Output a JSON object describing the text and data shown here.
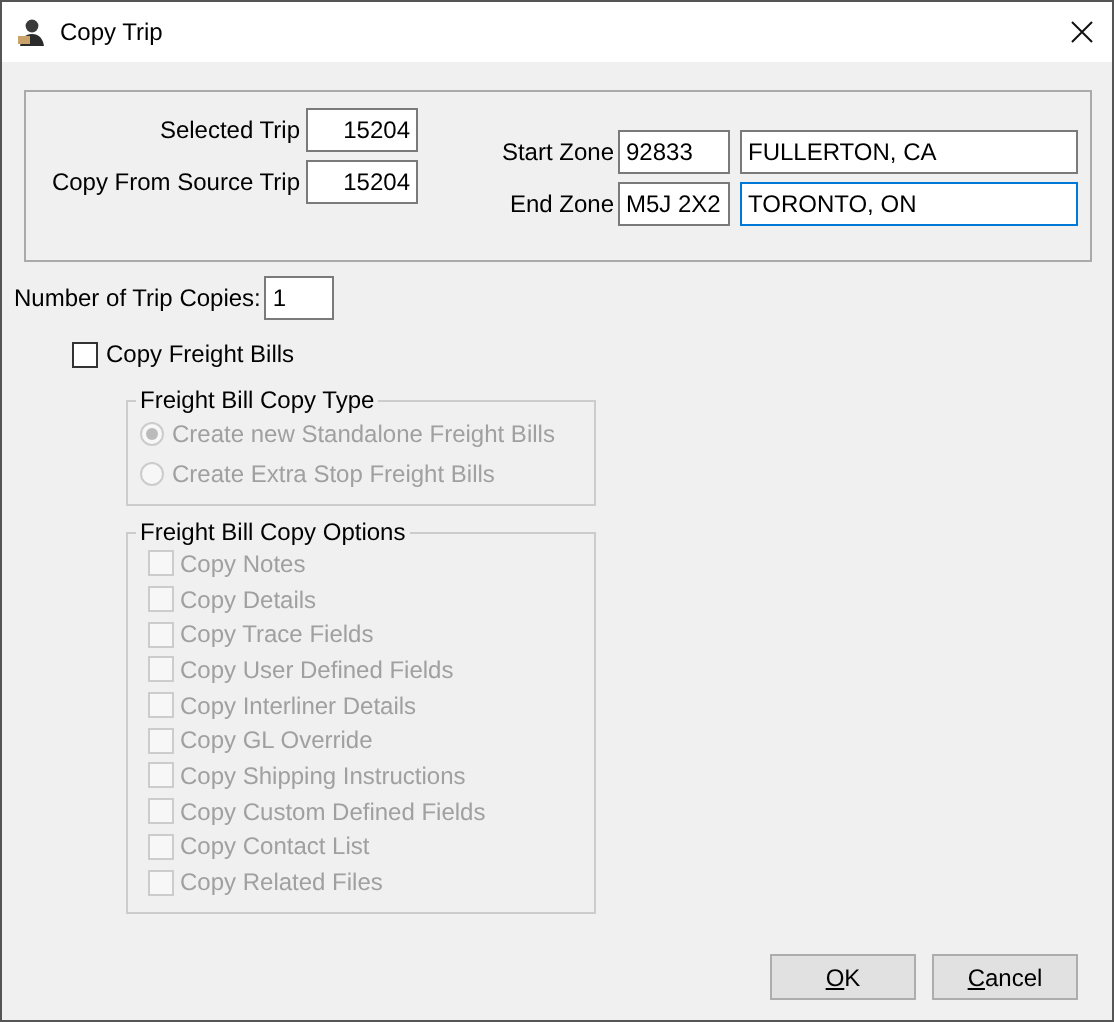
{
  "window": {
    "title": "Copy Trip"
  },
  "trip": {
    "selected_trip_label": "Selected Trip",
    "selected_trip": "15204",
    "source_trip_label": "Copy From Source Trip",
    "source_trip": "15204"
  },
  "zones": [
    {
      "label": "Start Zone",
      "code": "92833",
      "city": "FULLERTON, CA",
      "focused": false
    },
    {
      "label": "End Zone",
      "code": "M5J 2X2",
      "city": "TORONTO, ON",
      "focused": true
    }
  ],
  "copies": {
    "label": "Number of Trip Copies:",
    "value": "1"
  },
  "copy_freight_bills": {
    "label": "Copy Freight Bills",
    "checked": false
  },
  "copy_type": {
    "title": "Freight Bill Copy Type",
    "disabled": true,
    "options": [
      {
        "label": "Create new Standalone Freight Bills",
        "selected": true
      },
      {
        "label": "Create Extra Stop Freight Bills",
        "selected": false
      }
    ]
  },
  "copy_options": {
    "title": "Freight Bill Copy Options",
    "disabled": true,
    "options": [
      {
        "label": "Copy Notes",
        "checked": false
      },
      {
        "label": "Copy Details",
        "checked": false
      },
      {
        "label": "Copy Trace Fields",
        "checked": false
      },
      {
        "label": "Copy User Defined Fields",
        "checked": false
      },
      {
        "label": "Copy Interliner Details",
        "checked": false
      },
      {
        "label": "Copy GL Override",
        "checked": false
      },
      {
        "label": "Copy Shipping Instructions",
        "checked": false
      },
      {
        "label": "Copy Custom Defined Fields",
        "checked": false
      },
      {
        "label": "Copy Contact List",
        "checked": false
      },
      {
        "label": "Copy Related Files",
        "checked": false
      }
    ]
  },
  "buttons": [
    {
      "label": "OK"
    },
    {
      "label": "Cancel"
    }
  ]
}
